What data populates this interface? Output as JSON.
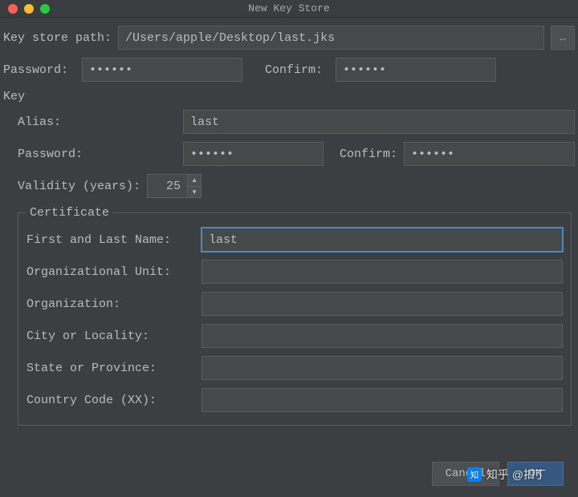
{
  "window": {
    "title": "New Key Store"
  },
  "keystore": {
    "path_label": "Key store path:",
    "path_value": "/Users/apple/Desktop/last.jks",
    "browse_label": "…",
    "password_label": "Password:",
    "password_value": "••••••",
    "confirm_label": "Confirm:",
    "confirm_value": "••••••"
  },
  "key": {
    "section_label": "Key",
    "alias_label": "Alias:",
    "alias_value": "last",
    "password_label": "Password:",
    "password_value": "••••••",
    "confirm_label": "Confirm:",
    "confirm_value": "••••••",
    "validity_label": "Validity (years):",
    "validity_value": "25"
  },
  "certificate": {
    "legend": "Certificate",
    "first_last_label": "First and Last Name:",
    "first_last_value": "last",
    "org_unit_label": "Organizational Unit:",
    "org_unit_value": "",
    "org_label": "Organization:",
    "org_value": "",
    "city_label": "City or Locality:",
    "city_value": "",
    "state_label": "State or Province:",
    "state_value": "",
    "country_label": "Country Code (XX):",
    "country_value": ""
  },
  "buttons": {
    "cancel": "Cancel",
    "ok": "OK"
  },
  "watermark": {
    "text": "知乎 @扣丁"
  }
}
